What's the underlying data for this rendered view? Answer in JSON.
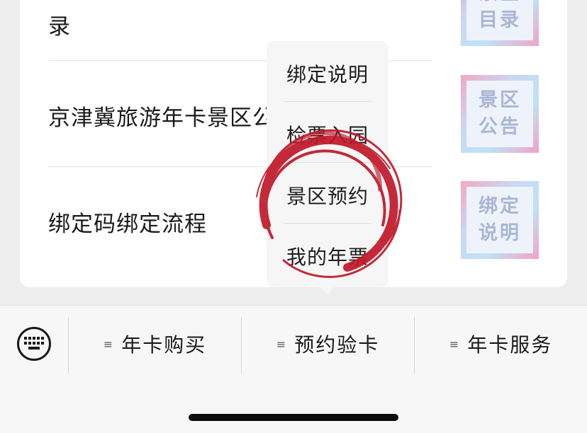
{
  "list": {
    "items": [
      {
        "title": "录",
        "thumb": "景区\n目录"
      },
      {
        "title": "京津冀旅游年卡景区公",
        "thumb": "景区\n公告"
      },
      {
        "title": "绑定码绑定流程",
        "thumb": "绑定\n说明"
      }
    ]
  },
  "popup": {
    "items": [
      "绑定说明",
      "检票入园",
      "景区预约",
      "我的年票"
    ]
  },
  "bottom_menu": {
    "buttons": [
      "年卡购买",
      "预约验卡",
      "年卡服务"
    ]
  },
  "colors": {
    "stamp": "#c0182a",
    "thumb_text": "#a9b6d6"
  },
  "icons": {
    "keyboard": "keyboard-icon",
    "menu": "hamburger-icon"
  }
}
